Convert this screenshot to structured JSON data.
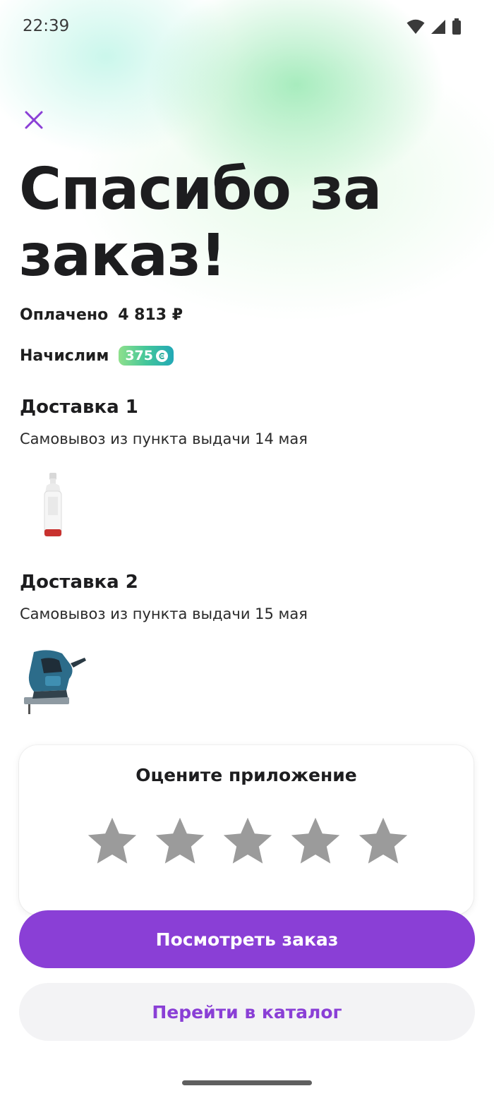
{
  "status_bar": {
    "time": "22:39",
    "icons": [
      "wifi-icon",
      "signal-icon",
      "battery-icon"
    ]
  },
  "header": {
    "close_icon": "close-icon",
    "title": "Спасибо за заказ!"
  },
  "payment": {
    "paid_label": "Оплачено",
    "paid_amount": "4 813 ₽"
  },
  "bonus": {
    "label": "Начислим",
    "amount": "375"
  },
  "deliveries": [
    {
      "title": "Доставка 1",
      "subtitle": "Самовывоз из пункта выдачи 14 мая",
      "product_icon": "spray-bottle-image"
    },
    {
      "title": "Доставка 2",
      "subtitle": "Самовывоз из пункта выдачи 15 мая",
      "product_icon": "jigsaw-image"
    }
  ],
  "rating": {
    "title": "Оцените приложение",
    "stars_total": 5,
    "stars_selected": 0
  },
  "buttons": {
    "view_order": "Посмотреть заказ",
    "go_catalog": "Перейти в каталог"
  },
  "colors": {
    "accent": "#8a3fd6",
    "star_inactive": "#9b9b9b",
    "secondary_bg": "#f3f3f5"
  }
}
